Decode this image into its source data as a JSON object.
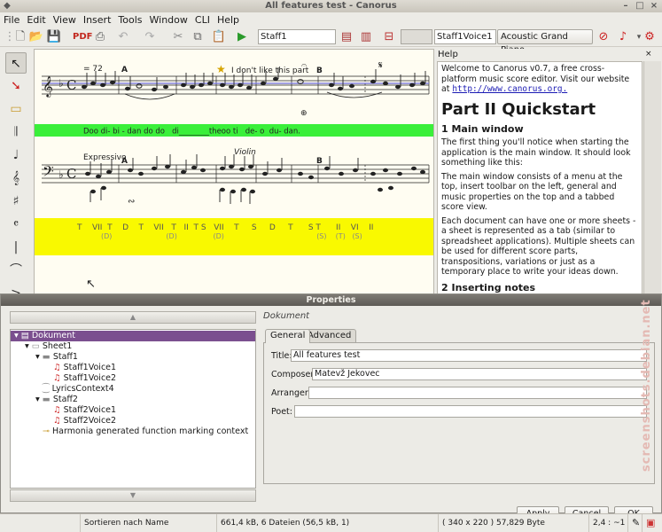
{
  "window": {
    "title": "All features test - Canorus"
  },
  "menubar": {
    "items": [
      "File",
      "Edit",
      "View",
      "Insert",
      "Tools",
      "Window",
      "CLI",
      "Help"
    ]
  },
  "toolbar": {
    "context_field": "Staff1",
    "voice_field": "Staff1Voice1",
    "instrument": "Acoustic Grand Piano"
  },
  "score": {
    "tempo": "= 72",
    "annotation": "I don't like this part",
    "lyrics": "Doo di- bi - dan do do   di________theoo ti   de- o  du- dan.",
    "expression": "Expressivo",
    "text_violin": "Violin",
    "markers": [
      "A",
      "B",
      "A",
      "B"
    ],
    "function_line": "T    VII  T    D    T    VII   T   II  T S   VII    T     S     D     T      S T      II    VI    II",
    "function_sub": "(D)                        (D)                (D)                                         (S)    (T)   (S)"
  },
  "help": {
    "title": "Help",
    "intro": "Welcome to Canorus v0.7, a free cross-platform music score editor. Visit our website at",
    "link": "http://www.canorus.org.",
    "part": "Part II Quickstart",
    "h_main": "1 Main window",
    "p1": "The first thing you'll notice when starting the application is the main window. It should look something like this:",
    "p2": "The main window consists of a menu at the top, insert toolbar on the left, general and music properties on the top and a tabbed score view.",
    "p3": "Each document can have one or more sheets - a sheet is represented as a tab (similar to spreadsheet applications). Multiple sheets can be used for different score parts, transpositions, variations or just as a temporary place to write your ideas down.",
    "h_insert": "2 Inserting notes"
  },
  "properties": {
    "title": "Properties",
    "section": "Dokument",
    "tree": [
      {
        "label": "Dokument",
        "level": 0,
        "icon": "document-icon"
      },
      {
        "label": "Sheet1",
        "level": 1,
        "icon": "sheet-icon"
      },
      {
        "label": "Staff1",
        "level": 2,
        "icon": "staff-icon"
      },
      {
        "label": "Staff1Voice1",
        "level": 3,
        "icon": "voice-icon"
      },
      {
        "label": "Staff1Voice2",
        "level": 3,
        "icon": "voice-icon"
      },
      {
        "label": "LyricsContext4",
        "level": 2,
        "icon": "lyrics-icon"
      },
      {
        "label": "Staff2",
        "level": 2,
        "icon": "staff-icon"
      },
      {
        "label": "Staff2Voice1",
        "level": 3,
        "icon": "voice-icon"
      },
      {
        "label": "Staff2Voice2",
        "level": 3,
        "icon": "voice-icon"
      },
      {
        "label": "Harmonia generated function marking context",
        "level": 2,
        "icon": "function-marking-icon"
      }
    ],
    "tabs": [
      "General",
      "Advanced"
    ],
    "fields": {
      "title_label": "Title:",
      "title_value": "All features test",
      "composer_label": "Composer:",
      "composer_value": "Matevž Jekovec",
      "arranger_label": "Arranger:",
      "arranger_value": "",
      "poet_label": "Poet:",
      "poet_value": ""
    },
    "buttons": {
      "apply": "Apply",
      "cancel": "Cancel",
      "ok": "OK"
    }
  },
  "statusbar": {
    "sort": "Sortieren nach Name",
    "size": "661,4 kB, 6 Dateien (56,5 kB, 1)",
    "image": "( 340 x 220 ) 57,829 Byte",
    "position": "2,4 : ~1"
  },
  "watermark": "screenshots.debian.net",
  "colors": {
    "lyrics_bg": "#3aef3a",
    "function_bg": "#f9f900",
    "selection": "#7b4f8f"
  }
}
